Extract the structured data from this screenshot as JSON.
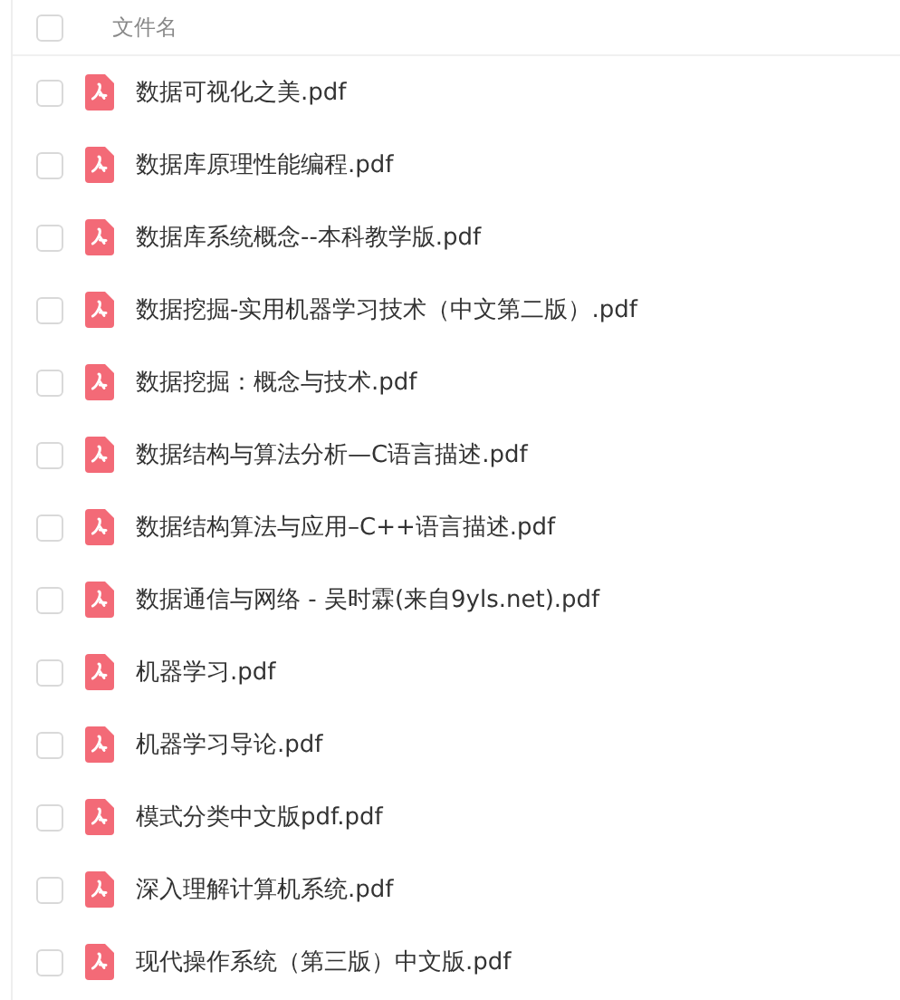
{
  "header": {
    "label": "文件名",
    "checked": false
  },
  "files": [
    {
      "name": "数据可视化之美.pdf",
      "checked": false
    },
    {
      "name": "数据库原理性能编程.pdf",
      "checked": false
    },
    {
      "name": "数据库系统概念--本科教学版.pdf",
      "checked": false
    },
    {
      "name": "数据挖掘-实用机器学习技术（中文第二版）.pdf",
      "checked": false
    },
    {
      "name": "数据挖掘：概念与技术.pdf",
      "checked": false
    },
    {
      "name": "数据结构与算法分析—C语言描述.pdf",
      "checked": false
    },
    {
      "name": "数据结构算法与应用–C++语言描述.pdf",
      "checked": false
    },
    {
      "name": "数据通信与网络 - 吴时霖(来自9yls.net).pdf",
      "checked": false
    },
    {
      "name": "机器学习.pdf",
      "checked": false
    },
    {
      "name": "机器学习导论.pdf",
      "checked": false
    },
    {
      "name": "模式分类中文版pdf.pdf",
      "checked": false
    },
    {
      "name": "深入理解计算机系统.pdf",
      "checked": false
    },
    {
      "name": "现代操作系统（第三版）中文版.pdf",
      "checked": false
    }
  ]
}
